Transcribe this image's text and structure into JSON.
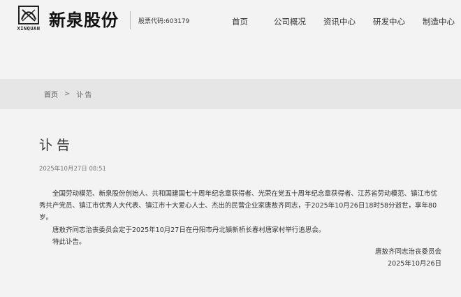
{
  "header": {
    "logo_latin": "XINQUAN",
    "logo_cn": "新泉股份",
    "stock_code": "股票代码:603179"
  },
  "nav": {
    "items": [
      {
        "label": "首页"
      },
      {
        "label": "公司概况"
      },
      {
        "label": "资讯中心"
      },
      {
        "label": "研发中心"
      },
      {
        "label": "制造中心"
      }
    ]
  },
  "breadcrumb": {
    "home": "首页",
    "separator": ">",
    "current": "讣告"
  },
  "article": {
    "title": "讣告",
    "date": "2025年10月27日 08:51",
    "paragraphs": [
      "全国劳动模范、新泉股份创始人、共和国建国七十周年纪念章获得者、光荣在党五十周年纪念章获得者、江苏省劳动模范、镇江市优秀共产党员、镇江市优秀人大代表、镇江市十大爱心人士、杰出的民营企业家唐敖齐同志，于2025年10月26日18时58分逝世，享年80岁。",
      "唐敖齐同志治丧委员会定于2025年10月27日在丹阳市丹北镇新桥长春村唐家村举行追思会。",
      "特此讣告。"
    ],
    "signature": "唐敖齐同志治丧委员会",
    "sign_date": "2025年10月26日"
  },
  "colors": {
    "page_bg": "#f3f3f3",
    "band_bg": "#e6e6e6",
    "text": "#333333"
  }
}
